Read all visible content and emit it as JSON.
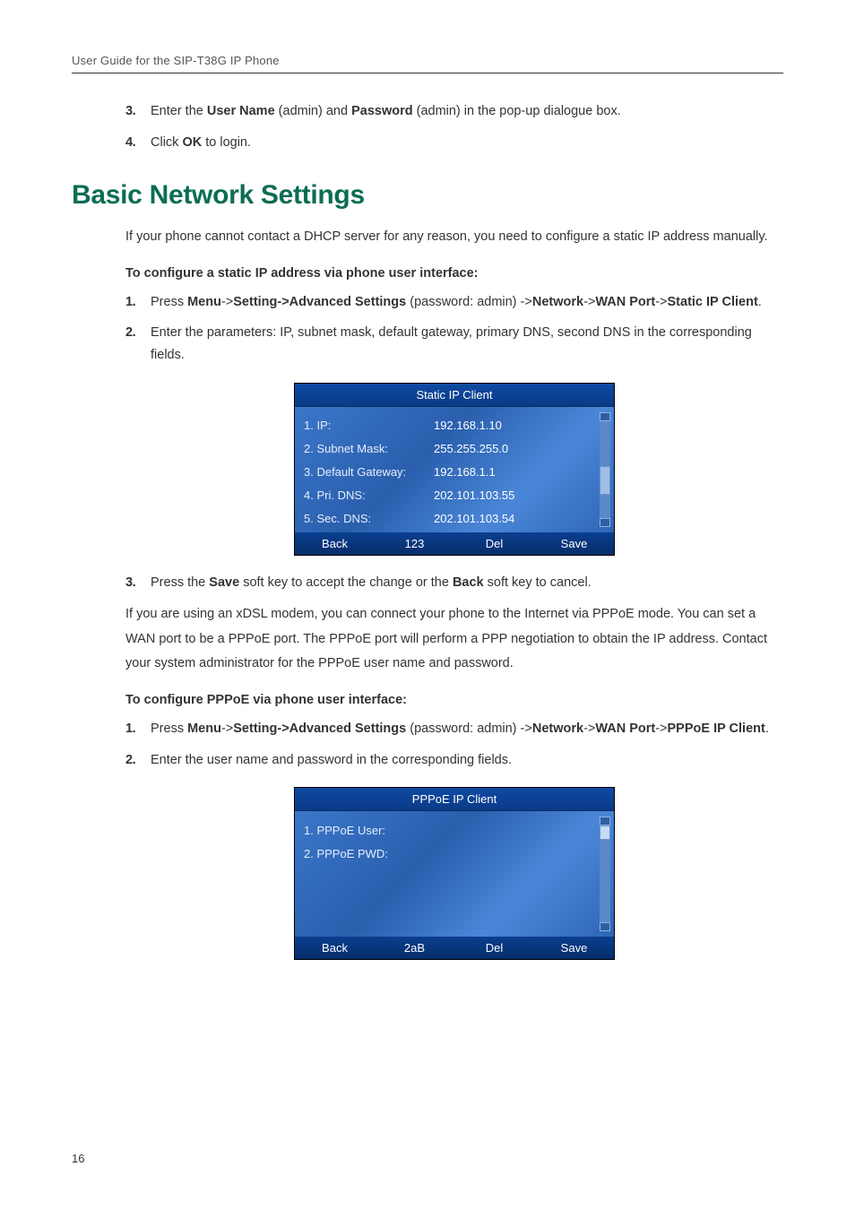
{
  "header": "User Guide for the SIP-T38G IP Phone",
  "top_steps": {
    "s3": {
      "num": "3.",
      "pre": "Enter the ",
      "b1": "User Name",
      "mid1": " (admin) and ",
      "b2": "Password",
      "mid2": " (admin) in the pop-up dialogue box."
    },
    "s4": {
      "num": "4.",
      "pre": "Click ",
      "b1": "OK",
      "post": " to login."
    }
  },
  "section_title": "Basic Network Settings",
  "para_intro": "If your phone cannot contact a DHCP server for any reason, you need to configure a static IP address manually.",
  "sub1": "To configure a static IP address via phone user interface:",
  "p1": {
    "s1": {
      "num": "1.",
      "pre": "Press ",
      "b1": "Menu",
      "a1": "->",
      "b2": "Setting->Advanced Settings",
      "mid": " (password: admin) ->",
      "b3": "Network",
      "a2": "->",
      "b4": "WAN Port",
      "a3": "->",
      "b5": "Static IP Client",
      "end": "."
    },
    "s2": {
      "num": "2.",
      "text": "Enter the parameters: IP, subnet mask, default gateway, primary DNS, second DNS in the corresponding fields."
    }
  },
  "phone1": {
    "title": "Static IP Client",
    "rows": [
      {
        "label": "1. IP:",
        "val": "192.168.1.10"
      },
      {
        "label": "2. Subnet Mask:",
        "val": "255.255.255.0"
      },
      {
        "label": "3. Default Gateway:",
        "val": "192.168.1.1"
      },
      {
        "label": "4. Pri. DNS:",
        "val": "202.101.103.55"
      },
      {
        "label": "5. Sec. DNS:",
        "val": "202.101.103.54"
      }
    ],
    "soft": [
      "Back",
      "123",
      "Del",
      "Save"
    ]
  },
  "p1_s3": {
    "num": "3.",
    "pre": "Press the ",
    "b1": "Save",
    "mid": " soft key to accept the change or the ",
    "b2": "Back",
    "post": " soft key to cancel."
  },
  "para_xdsl": "If you are using an xDSL modem, you can connect your phone to the Internet via PPPoE mode. You can set a WAN port to be a PPPoE port. The PPPoE port will perform a PPP negotiation to obtain the IP address. Contact your system administrator for the PPPoE user name and password.",
  "sub2": "To configure PPPoE via phone user interface:",
  "p2": {
    "s1": {
      "num": "1.",
      "pre": "Press ",
      "b1": "Menu",
      "a1": "->",
      "b2": "Setting->Advanced Settings",
      "mid": " (password: admin) ->",
      "b3": "Network",
      "a2": "->",
      "b4": "WAN Port",
      "a3": "->",
      "b5": "PPPoE IP Client",
      "end": "."
    },
    "s2": {
      "num": "2.",
      "text": "Enter the user name and password in the corresponding fields."
    }
  },
  "phone2": {
    "title": "PPPoE IP Client",
    "rows": [
      {
        "label": "1. PPPoE User:",
        "val": ""
      },
      {
        "label": "2. PPPoE PWD:",
        "val": ""
      }
    ],
    "soft": [
      "Back",
      "2aB",
      "Del",
      "Save"
    ]
  },
  "page_num": "16"
}
